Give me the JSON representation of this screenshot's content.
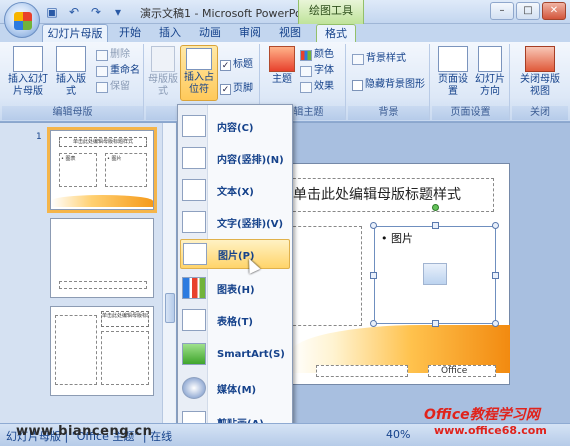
{
  "window": {
    "title": "演示文稿1 - Microsoft PowerPoi...",
    "context_tab_group": "绘图工具",
    "controls": [
      "–",
      "□",
      "✕"
    ]
  },
  "tabs": [
    {
      "label": "幻灯片母版",
      "active": true
    },
    {
      "label": "开始"
    },
    {
      "label": "插入"
    },
    {
      "label": "动画"
    },
    {
      "label": "审阅"
    },
    {
      "label": "视图"
    },
    {
      "label": "格式",
      "context": true
    }
  ],
  "ribbon": {
    "edit_master": {
      "label": "编辑母版",
      "insert_master": "插入幻灯片母版",
      "insert_layout": "插入版式",
      "delete": "删除",
      "rename": "重命名",
      "preserve": "保留"
    },
    "master_layout": {
      "label": "母版版式",
      "master_layout_btn": "母版版式",
      "insert_placeholder": "插入占位符",
      "title_check": "标题",
      "footer_check": "页脚",
      "title_checked": true,
      "footer_checked": true
    },
    "edit_theme": {
      "label": "编辑主题",
      "theme": "主题",
      "colors": "颜色",
      "fonts": "字体",
      "effects": "效果"
    },
    "background": {
      "label": "背景",
      "bg_styles": "背景样式",
      "hide_bg": "隐藏背景图形"
    },
    "page_setup": {
      "label": "页面设置",
      "page_setup_btn": "页面设置",
      "orientation": "幻灯片方向"
    },
    "close": {
      "label": "关闭",
      "close_btn": "关闭母版视图"
    }
  },
  "thumbnails": [
    {
      "title": "单击此处编辑母版标题样式",
      "selected": true,
      "left_label": "• 图表",
      "right_label": "• 图片"
    },
    {
      "title": "",
      "selected": false
    },
    {
      "title": "单击此处编辑母版标题样式",
      "selected": false
    }
  ],
  "slide": {
    "title": "单击此处编辑母版标题样式",
    "picture_bullet": "• 图片",
    "footer_logo": "Office"
  },
  "placeholder_menu": {
    "items": [
      {
        "label": "内容(C)",
        "icon": "content-icon"
      },
      {
        "label": "内容(竖排)(N)",
        "icon": "content-vertical-icon"
      },
      {
        "label": "文本(X)",
        "icon": "text-icon"
      },
      {
        "label": "文字(竖排)(V)",
        "icon": "text-vertical-icon"
      },
      {
        "label": "图片(P)",
        "icon": "picture-icon",
        "highlighted": true
      },
      {
        "label": "图表(H)",
        "icon": "chart-icon"
      },
      {
        "label": "表格(T)",
        "icon": "table-icon"
      },
      {
        "label": "SmartArt(S)",
        "icon": "smartart-icon"
      },
      {
        "label": "媒体(M)",
        "icon": "media-icon"
      },
      {
        "label": "剪贴画(A)",
        "icon": "clipart-icon"
      }
    ]
  },
  "status": {
    "left": "幻灯片母版 | \"Office 主题\" | 在线",
    "zoom": "40%"
  },
  "watermarks": {
    "site1": "www.bianceng.cn",
    "site2": "Office教程学习网",
    "site3": "www.office68.com"
  },
  "colors": {
    "ribbon_bg": "#dde8f7",
    "highlight": "#ffd46a",
    "context_green": "#bfe39a",
    "text_blue": "#15428b"
  }
}
